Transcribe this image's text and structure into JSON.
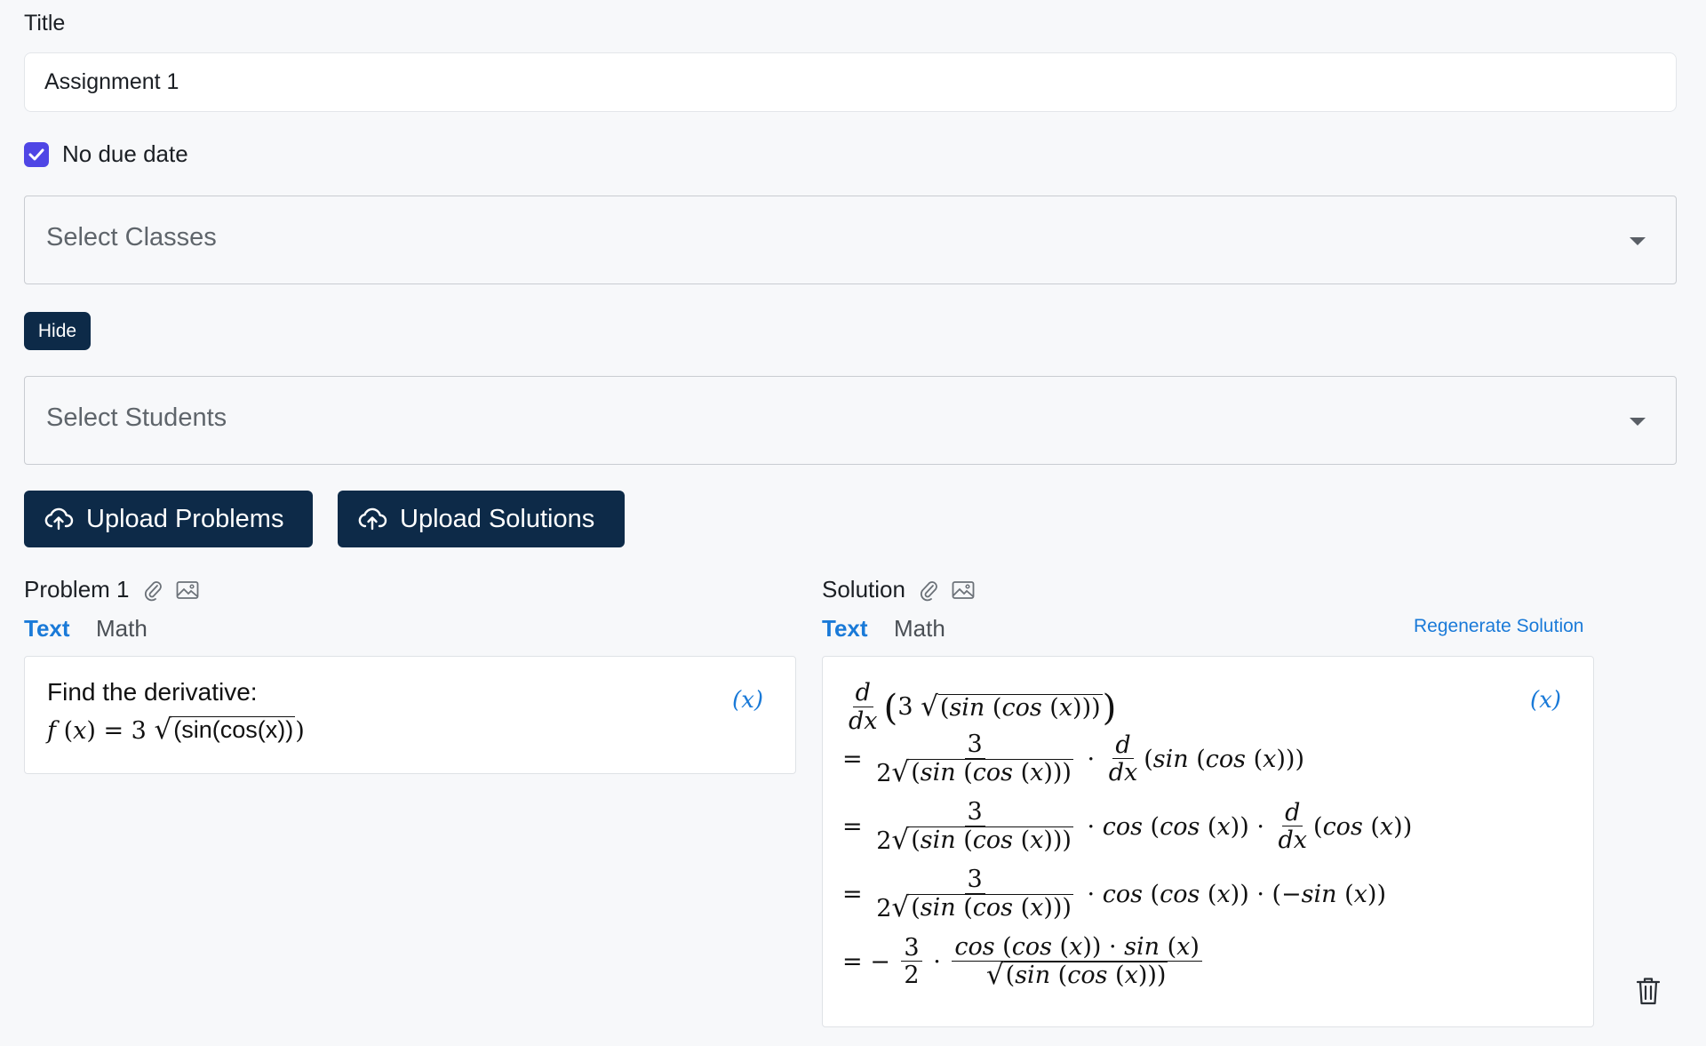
{
  "form": {
    "title_label": "Title",
    "title_value": "Assignment 1",
    "no_due_date_label": "No due date",
    "no_due_date_checked": true,
    "classes_placeholder": "Select Classes",
    "hide_label": "Hide",
    "students_placeholder": "Select Students",
    "upload_problems_label": "Upload Problems",
    "upload_solutions_label": "Upload Solutions"
  },
  "problem": {
    "label": "Problem 1",
    "tabs": [
      "Text",
      "Math"
    ],
    "active_tab": "Text",
    "text": "Find the derivative:",
    "formula": "f(x) = 3√(sin(cos(x)))",
    "formula_arg": "(sin(cos(x))",
    "var_icon": "(x)",
    "icons": [
      "paperclip-icon",
      "image-icon"
    ]
  },
  "solution": {
    "label": "Solution",
    "tabs": [
      "Text",
      "Math"
    ],
    "active_tab": "Text",
    "regenerate_label": "Regenerate Solution",
    "var_icon": "(x)",
    "icons": [
      "paperclip-icon",
      "image-icon",
      "trash-icon"
    ],
    "steps": [
      "d/dx (3√(sin(cos(x))))",
      "= 3/(2√(sin(cos(x)))) · d/dx (sin(cos(x)))",
      "= 3/(2√(sin(cos(x)))) · cos(cos(x)) · d/dx (cos(x))",
      "= 3/(2√(sin(cos(x)))) · cos(cos(x)) · (−sin(x))",
      "= −3/2 · cos(cos(x)) · sin(x) / √(sin(cos(x)))"
    ]
  },
  "colors": {
    "primary_dark": "#0d2a48",
    "link_blue": "#1a7ad8",
    "checkbox": "#4f46e5"
  }
}
